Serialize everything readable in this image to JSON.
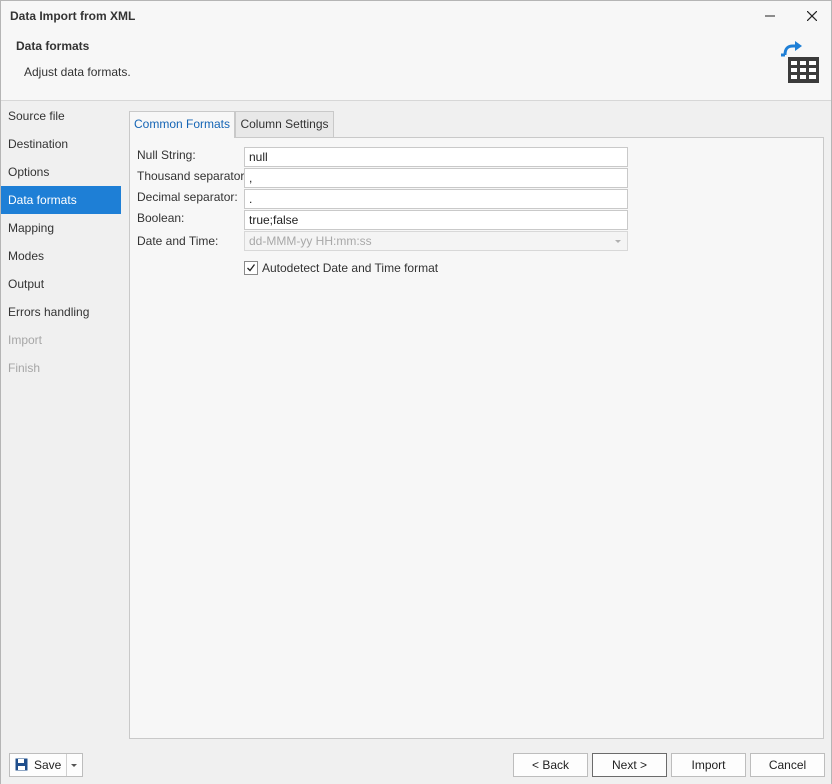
{
  "window": {
    "title": "Data Import from XML",
    "controls": [
      "minimize-icon",
      "maximize-icon",
      "close-icon"
    ]
  },
  "header": {
    "title": "Data formats",
    "subtitle": "Adjust data formats.",
    "icon": "import-table-icon"
  },
  "sidebar": {
    "items": [
      {
        "label": "Source file",
        "state": "normal"
      },
      {
        "label": "Destination",
        "state": "normal"
      },
      {
        "label": "Options",
        "state": "normal"
      },
      {
        "label": "Data formats",
        "state": "active"
      },
      {
        "label": "Mapping",
        "state": "normal"
      },
      {
        "label": "Modes",
        "state": "normal"
      },
      {
        "label": "Output",
        "state": "normal"
      },
      {
        "label": "Errors handling",
        "state": "normal"
      },
      {
        "label": "Import",
        "state": "disabled"
      },
      {
        "label": "Finish",
        "state": "disabled"
      }
    ]
  },
  "tabs": [
    {
      "label": "Common Formats",
      "active": true
    },
    {
      "label": "Column Settings",
      "active": false
    }
  ],
  "form": {
    "null_string": {
      "label": "Null String:",
      "value": "null"
    },
    "thousand_separator": {
      "label": "Thousand separator:",
      "value": ","
    },
    "decimal_separator": {
      "label": "Decimal separator:",
      "value": "."
    },
    "boolean": {
      "label": "Boolean:",
      "value": "true;false"
    },
    "date_time": {
      "label": "Date and Time:",
      "value": "dd-MMM-yy HH:mm:ss",
      "disabled": true
    },
    "autodetect": {
      "label": "Autodetect Date and Time format",
      "checked": true
    }
  },
  "footer": {
    "save": "Save",
    "back": "< Back",
    "next": "Next >",
    "import": "Import",
    "cancel": "Cancel"
  },
  "colors": {
    "accent": "#1e7fd6",
    "tab_active_text": "#1565b5",
    "disabled_text": "#a6a6a6"
  }
}
